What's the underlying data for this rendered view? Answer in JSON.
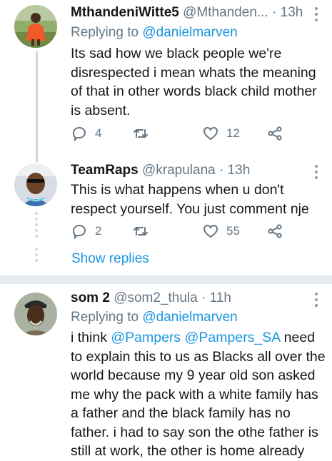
{
  "tweets": [
    {
      "name": "MthandeniWitte5",
      "handle": "@Mthanden...",
      "time": "· 13h",
      "replying_prefix": "Replying to ",
      "replying_user": "@danielmarven",
      "text": "Its sad how we black people we're disrespected i mean whats the meaning of that in other words black child mother is absent.",
      "replies": "4",
      "retweets": "",
      "likes": "12"
    },
    {
      "name": "TeamRaps",
      "handle": "@krapulana",
      "time": "· 13h",
      "text": "This is what happens when u don't respect yourself. You just comment nje",
      "replies": "2",
      "retweets": "",
      "likes": "55"
    },
    {
      "name": "som 2",
      "handle": "@som2_thula",
      "time": "· 11h",
      "replying_prefix": "Replying to ",
      "replying_user": "@danielmarven",
      "text_prefix": "i think ",
      "mention1": "@Pampers",
      "mention2": "@Pampers_SA",
      "text_rest": " need to explain this to us as Blacks all over the world because my 9 year old son asked me why the pack with a white family has a father and the black family has  no father. i had to say son the othe father is still at work, the other is home already"
    }
  ],
  "show_replies": "Show replies",
  "icons": {
    "reply": "reply-icon",
    "retweet": "retweet-icon",
    "like": "heart-icon",
    "share": "share-icon",
    "more": "more-vertical-icon"
  },
  "colors": {
    "link": "#1b95e0",
    "secondary_text": "#657786",
    "thread_line": "#cfd9de"
  }
}
